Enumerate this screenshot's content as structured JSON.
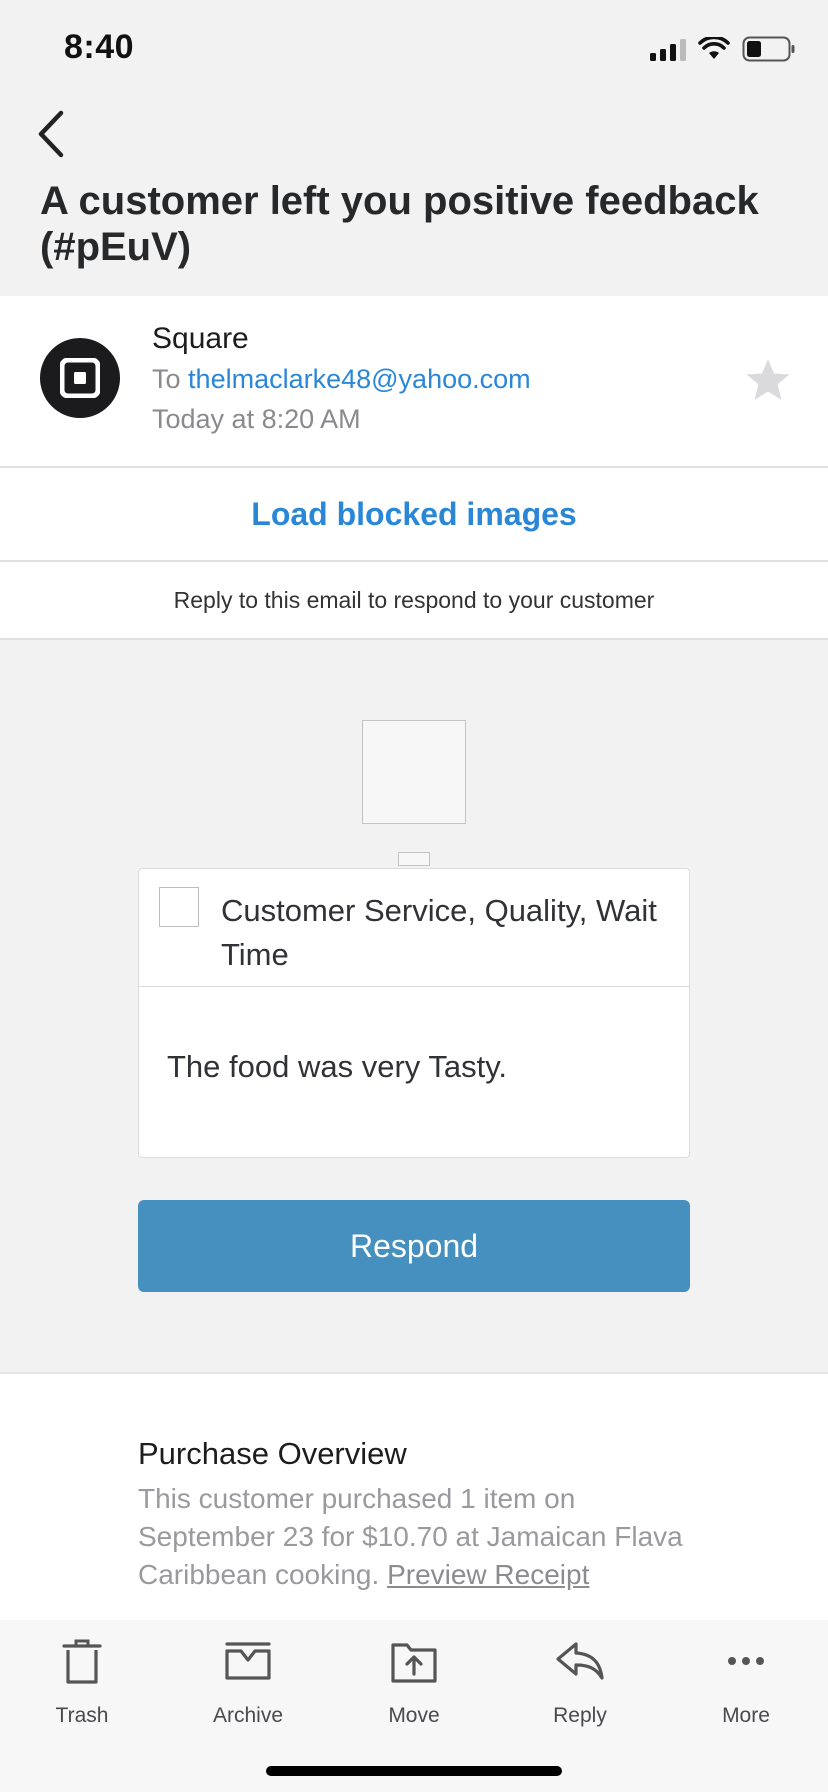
{
  "status_bar": {
    "time": "8:40"
  },
  "email": {
    "subject": "A customer left you positive feedback (#pEuV)",
    "sender_name": "Square",
    "to_prefix": "To",
    "to_address": "thelmaclarke48@yahoo.com",
    "date": "Today at 8:20 AM"
  },
  "load_images_label": "Load blocked images",
  "reply_note": "Reply to this email to respond to your customer",
  "feedback": {
    "tags": "Customer Service, Quality, Wait Time",
    "comment": "The food was very Tasty.",
    "respond_label": "Respond"
  },
  "purchase": {
    "title": "Purchase Overview",
    "text": "This customer purchased 1 item on September 23 for $10.70 at Jamaican Flava Caribbean cooking.",
    "link": "Preview Receipt"
  },
  "toolbar": {
    "trash": "Trash",
    "archive": "Archive",
    "move": "Move",
    "reply": "Reply",
    "more": "More"
  },
  "colors": {
    "link_blue": "#2a87d8",
    "respond_button": "#4590bf",
    "background": "#f2f2f3"
  },
  "icons": {
    "back": "chevron-left-icon",
    "star": "star-icon",
    "trash": "trash-icon",
    "archive": "archive-icon",
    "move": "move-icon",
    "reply": "reply-icon",
    "more": "more-icon"
  }
}
